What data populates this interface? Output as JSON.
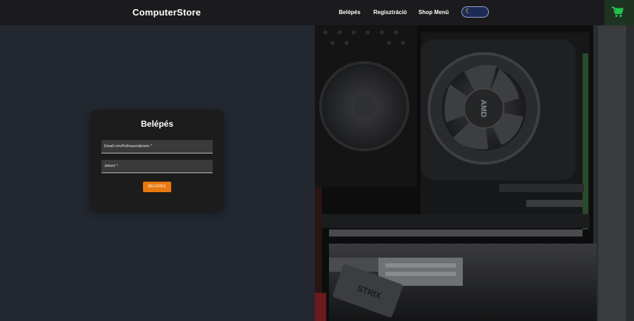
{
  "navbar": {
    "brand": "ComputerStore",
    "links": [
      "Belépés",
      "Regisztráció",
      "Shop Menü"
    ],
    "cart_icon": "shopping-cart-icon",
    "theme_icon": "moon-icon",
    "cart_color": "#21c44a"
  },
  "login": {
    "title": "Belépés",
    "email_placeholder": "Email cím/Felhasználónév *",
    "password_placeholder": "Jelszó *",
    "submit_label": "BELÉPÉS",
    "accent": "#e8790f"
  },
  "hero_photo": {
    "gpu_label": "STRIX",
    "cooler_label": "AMD"
  }
}
